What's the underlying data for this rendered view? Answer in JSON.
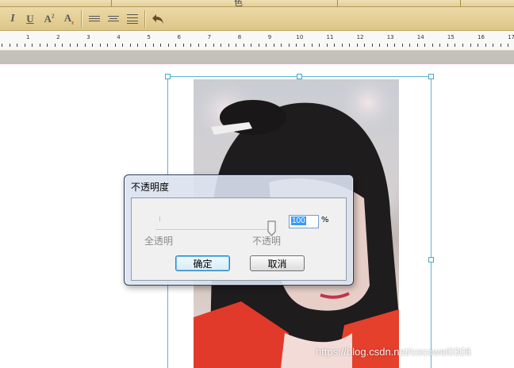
{
  "menu": {
    "fragment": "色"
  },
  "toolbar": {
    "italic_label": "I",
    "underline_label": "U",
    "superscript_label": "A",
    "superscript_mark": "2",
    "subscript_label": "A",
    "subscript_mark": "z",
    "icons": [
      "align-left-icon",
      "align-center-icon",
      "align-justify-icon",
      "undo-icon"
    ]
  },
  "ruler": {
    "numbers": [
      "1",
      "2",
      "3",
      "4",
      "5",
      "6",
      "7",
      "8",
      "9",
      "10",
      "11",
      "12",
      "13",
      "14",
      "15",
      "16",
      "17"
    ]
  },
  "dialog": {
    "title": "不透明度",
    "value": "100",
    "unit": "%",
    "label_min": "全透明",
    "label_max": "不透明",
    "opacity_level_percent": 100,
    "ok_label": "确定",
    "cancel_label": "取消"
  },
  "watermark": "https://blog.csdn.net/cocowei0306",
  "colors": {
    "toolbar": "#e2cf98",
    "dialog_frame": "#2a3b57",
    "selection": "#5fb4d4",
    "text_highlight": "#3399ff"
  }
}
